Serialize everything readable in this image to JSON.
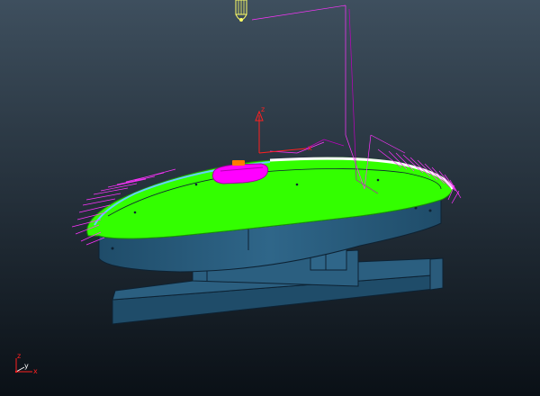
{
  "viewport": {
    "background_top": "#3e4f5e",
    "background_bottom": "#0a1016"
  },
  "colors": {
    "part_body": "#2b5f80",
    "part_edge": "#0d2233",
    "machined_surface": "#33ff00",
    "selected_region": "#ff00ff",
    "toolpath": "#ff33ff",
    "toolpath_alt": "#c000c0",
    "tool": "#ffff66",
    "axis_red": "#ff2020",
    "axis_white": "#ffffff",
    "rim_cyan": "#66ccff"
  },
  "workplane_triad": {
    "z_label": "z",
    "x_label": "x"
  },
  "corner_triad": {
    "z_label": "z",
    "y_label": "y",
    "x_label": "x"
  },
  "tool_icon": "tool-holder-icon"
}
